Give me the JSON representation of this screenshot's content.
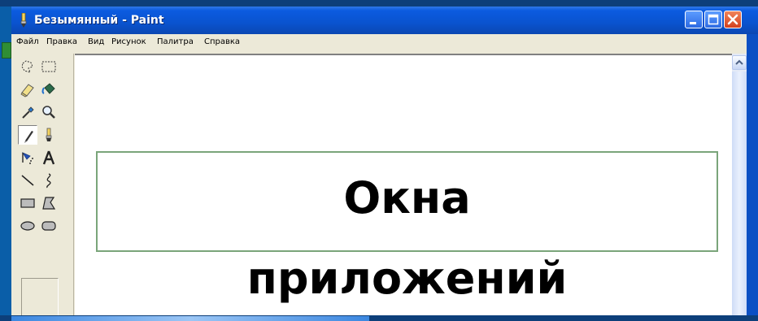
{
  "window": {
    "title": "Безымянный - Paint",
    "app_icon": "paint-icon",
    "controls": [
      "minimize-icon",
      "maximize-icon",
      "close-icon"
    ]
  },
  "menu": {
    "items": [
      "Файл",
      "Правка",
      "Вид",
      "Рисунок",
      "Палитра",
      "Справка"
    ]
  },
  "toolbox": {
    "tools": [
      {
        "name": "free-form-select-icon"
      },
      {
        "name": "rect-select-icon"
      },
      {
        "name": "eraser-icon"
      },
      {
        "name": "fill-icon"
      },
      {
        "name": "color-picker-icon"
      },
      {
        "name": "magnifier-icon"
      },
      {
        "name": "pencil-icon",
        "active": true
      },
      {
        "name": "brush-icon"
      },
      {
        "name": "airbrush-icon"
      },
      {
        "name": "text-icon"
      },
      {
        "name": "line-icon"
      },
      {
        "name": "curve-icon"
      },
      {
        "name": "rectangle-icon"
      },
      {
        "name": "polygon-icon"
      },
      {
        "name": "ellipse-icon"
      },
      {
        "name": "rounded-rect-icon"
      }
    ]
  },
  "slide": {
    "title_line1": "Окна",
    "title_line2": "приложений"
  },
  "colors": {
    "titlebar": "#0a53cf",
    "window_bg": "#ece9d8",
    "desktop_bg": "#0a5ea8",
    "close_button": "#d3401d",
    "title_box_border": "#7aa57a"
  }
}
